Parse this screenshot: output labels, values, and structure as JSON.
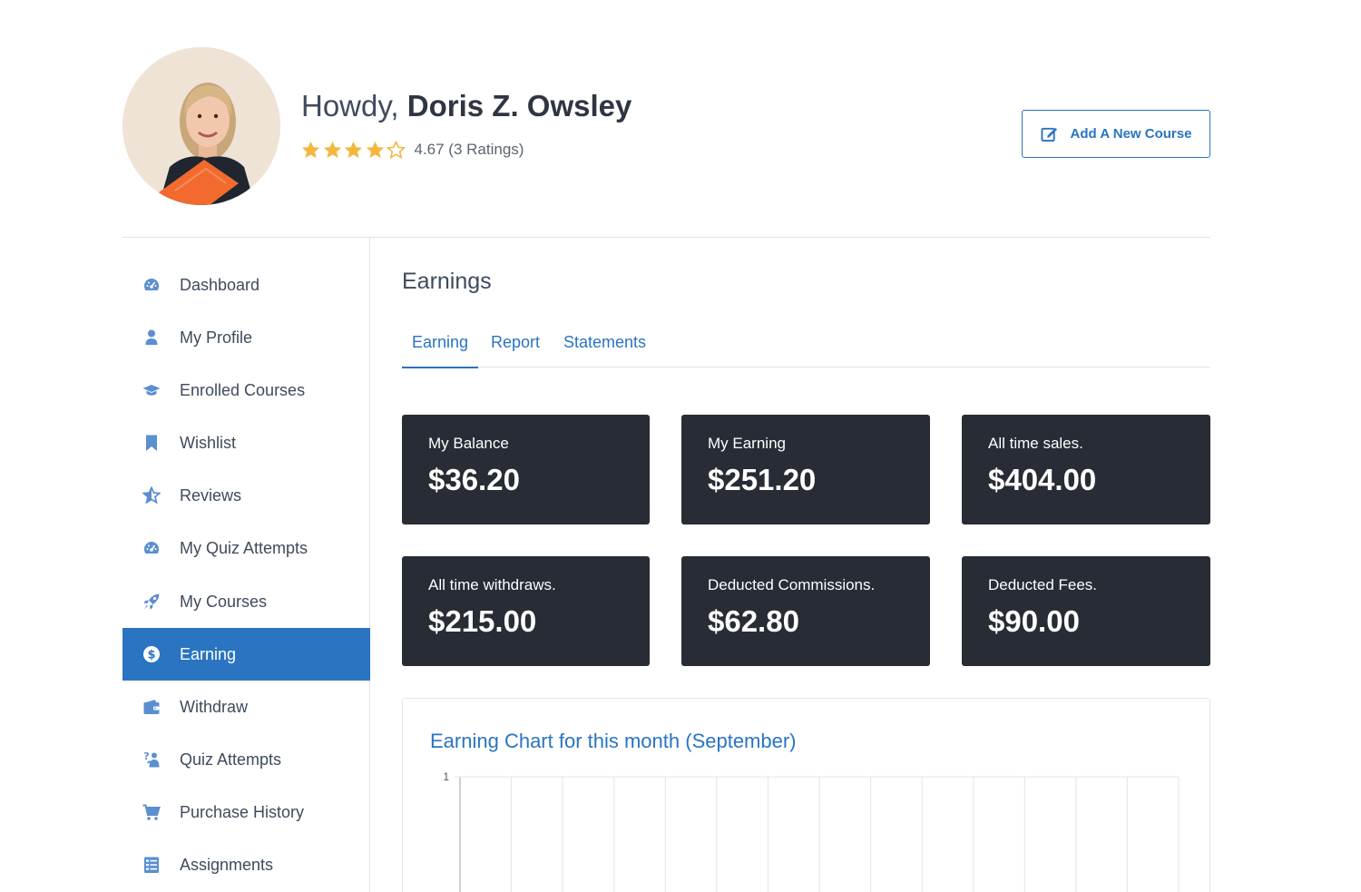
{
  "header": {
    "greeting_prefix": "Howdy,",
    "user_name": "Doris Z. Owsley",
    "rating": {
      "value": 4.67,
      "stars_filled": 4,
      "stars_total": 5,
      "text": "4.67 (3 Ratings)"
    },
    "add_course_label": "Add A New Course"
  },
  "sidebar": {
    "items": [
      {
        "label": "Dashboard",
        "icon": "dashboard-gauge-icon",
        "active": false
      },
      {
        "label": "My Profile",
        "icon": "user-icon",
        "active": false
      },
      {
        "label": "Enrolled Courses",
        "icon": "graduation-cap-icon",
        "active": false
      },
      {
        "label": "Wishlist",
        "icon": "bookmark-icon",
        "active": false
      },
      {
        "label": "Reviews",
        "icon": "star-icon",
        "active": false
      },
      {
        "label": "My Quiz Attempts",
        "icon": "gauge-icon",
        "active": false
      },
      {
        "label": "My Courses",
        "icon": "rocket-icon",
        "active": false
      },
      {
        "label": "Earning",
        "icon": "dollar-circle-icon",
        "active": true
      },
      {
        "label": "Withdraw",
        "icon": "wallet-icon",
        "active": false
      },
      {
        "label": "Quiz Attempts",
        "icon": "question-person-icon",
        "active": false
      },
      {
        "label": "Purchase History",
        "icon": "cart-icon",
        "active": false
      },
      {
        "label": "Assignments",
        "icon": "clipboard-list-icon",
        "active": false
      }
    ]
  },
  "main": {
    "title": "Earnings",
    "tabs": [
      {
        "label": "Earning",
        "active": true
      },
      {
        "label": "Report",
        "active": false
      },
      {
        "label": "Statements",
        "active": false
      }
    ],
    "cards": [
      {
        "label": "My Balance",
        "value": "$36.20"
      },
      {
        "label": "My Earning",
        "value": "$251.20"
      },
      {
        "label": "All time sales.",
        "value": "$404.00"
      },
      {
        "label": "All time withdraws.",
        "value": "$215.00"
      },
      {
        "label": "Deducted Commissions.",
        "value": "$62.80"
      },
      {
        "label": "Deducted Fees.",
        "value": "$90.00"
      }
    ],
    "chart_title": "Earning Chart for this month (September)"
  },
  "colors": {
    "accent": "#2a74c1",
    "card_bg": "#282c35",
    "star": "#f4b73e",
    "text": "#3e4b5c",
    "icon": "#5b8fd0"
  },
  "chart_data": {
    "type": "line",
    "title": "Earning Chart for this month (September)",
    "y_tick_labels": [
      "1"
    ],
    "ylim": [
      0,
      1
    ],
    "grid": true,
    "series": []
  }
}
